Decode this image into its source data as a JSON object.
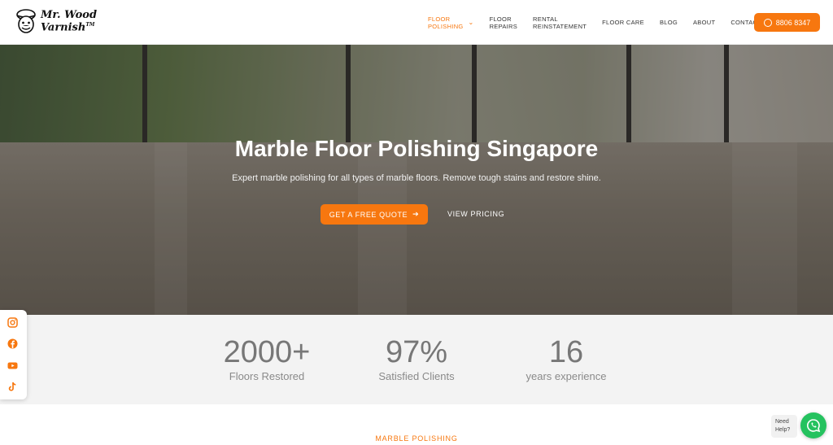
{
  "brand": {
    "line1": "Mr. Wood",
    "line2": "Varnish",
    "tm": "TM"
  },
  "nav": {
    "items": [
      {
        "label": "FLOOR\nPOLISHING",
        "active": true
      },
      {
        "label": "FLOOR\nREPAIRS"
      },
      {
        "label": "RENTAL\nREINSTATEMENT"
      },
      {
        "label": "FLOOR CARE"
      },
      {
        "label": "BLOG"
      },
      {
        "label": "ABOUT"
      },
      {
        "label": "CONTACT US"
      }
    ],
    "phone": "8806 8347"
  },
  "hero": {
    "title": "Marble Floor Polishing Singapore",
    "subtitle": "Expert marble polishing for all types of marble floors. Remove tough stains and restore shine.",
    "cta_primary": "GET A FREE QUOTE",
    "cta_secondary": "VIEW PRICING"
  },
  "stats": [
    {
      "value": "2000+",
      "label": "Floors Restored"
    },
    {
      "value": "97%",
      "label": "Satisfied Clients"
    },
    {
      "value": "16",
      "label": "years experience"
    }
  ],
  "social": [
    "instagram-icon",
    "facebook-icon",
    "youtube-icon",
    "tiktok-icon"
  ],
  "section_label": "MARBLE POLISHING",
  "chat": {
    "need_help_line1": "Need",
    "need_help_line2": "Help?"
  },
  "colors": {
    "accent": "#f7770f",
    "whatsapp": "#25c25f",
    "stats_bg": "#f3f3f3"
  }
}
